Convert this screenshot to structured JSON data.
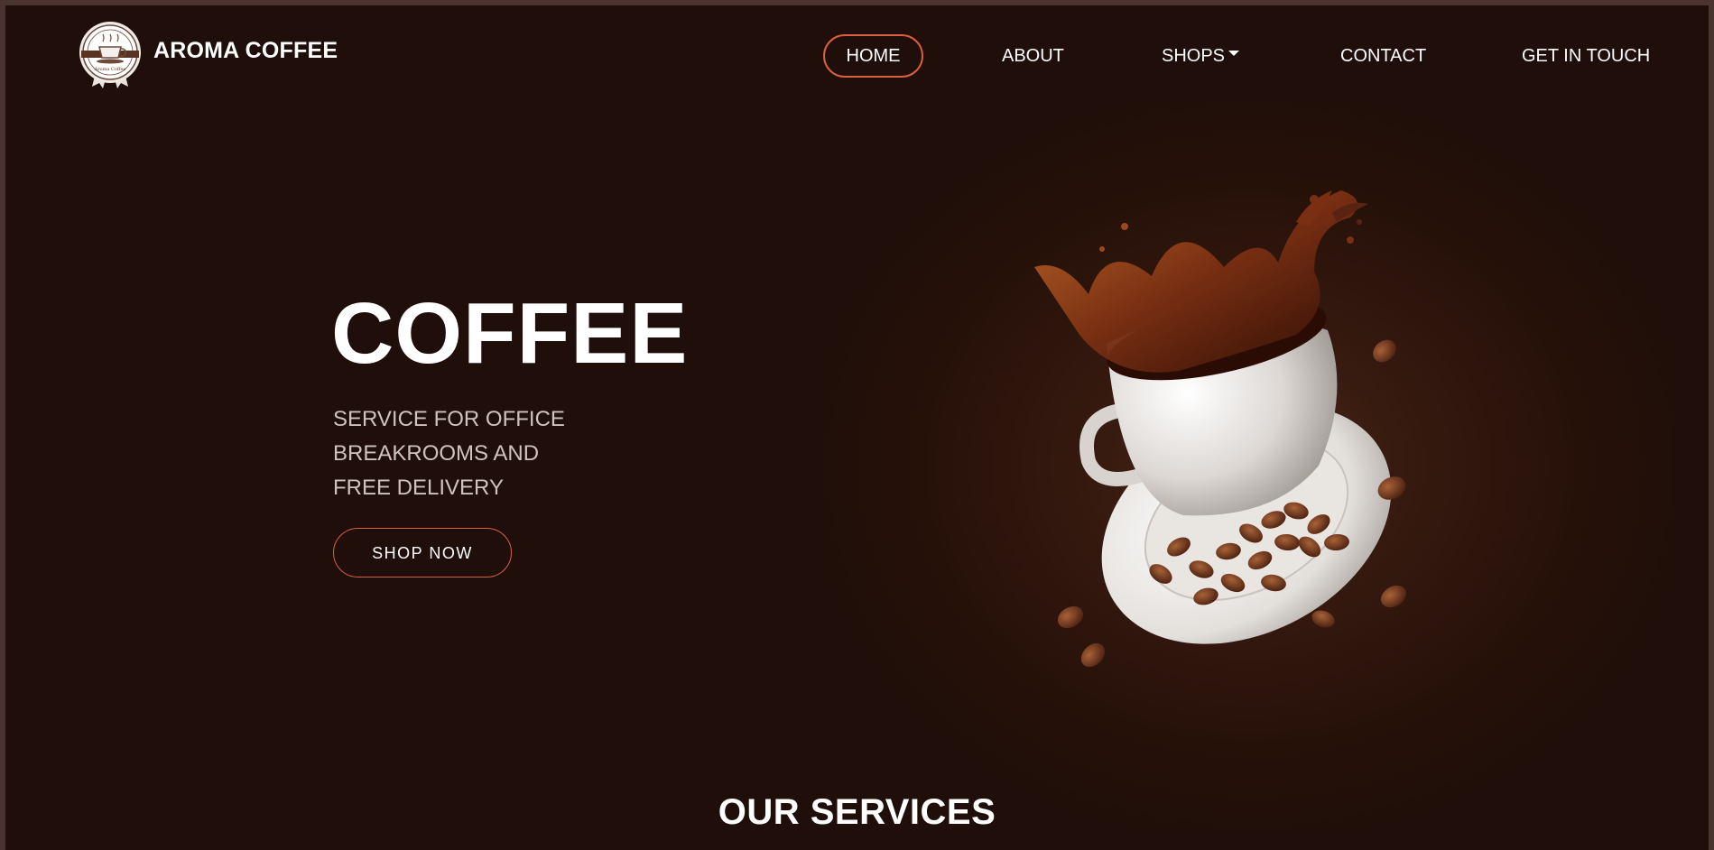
{
  "brand": {
    "name": "AROMA COFFEE",
    "logo_icon": "coffee-cup-badge-icon",
    "badge_text": "Aroma Coffee"
  },
  "nav": {
    "items": [
      {
        "label": "HOME",
        "active": true
      },
      {
        "label": "ABOUT",
        "active": false
      },
      {
        "label": "SHOPS",
        "active": false,
        "dropdown": true
      },
      {
        "label": "CONTACT",
        "active": false
      },
      {
        "label": "GET IN TOUCH",
        "active": false
      }
    ]
  },
  "hero": {
    "title": "COFFEE",
    "subtitle_lines": [
      "SERVICE FOR OFFICE",
      "BREAKROOMS AND",
      "FREE DELIVERY"
    ],
    "cta_label": "SHOP NOW",
    "image_icon": "coffee-cup-splash-icon"
  },
  "services": {
    "title": "OUR SERVICES"
  },
  "colors": {
    "background": "#1f0e09",
    "frame": "#4a3430",
    "accent": "#d9603c",
    "text": "#ffffff",
    "subtext": "#cfc3bd"
  }
}
